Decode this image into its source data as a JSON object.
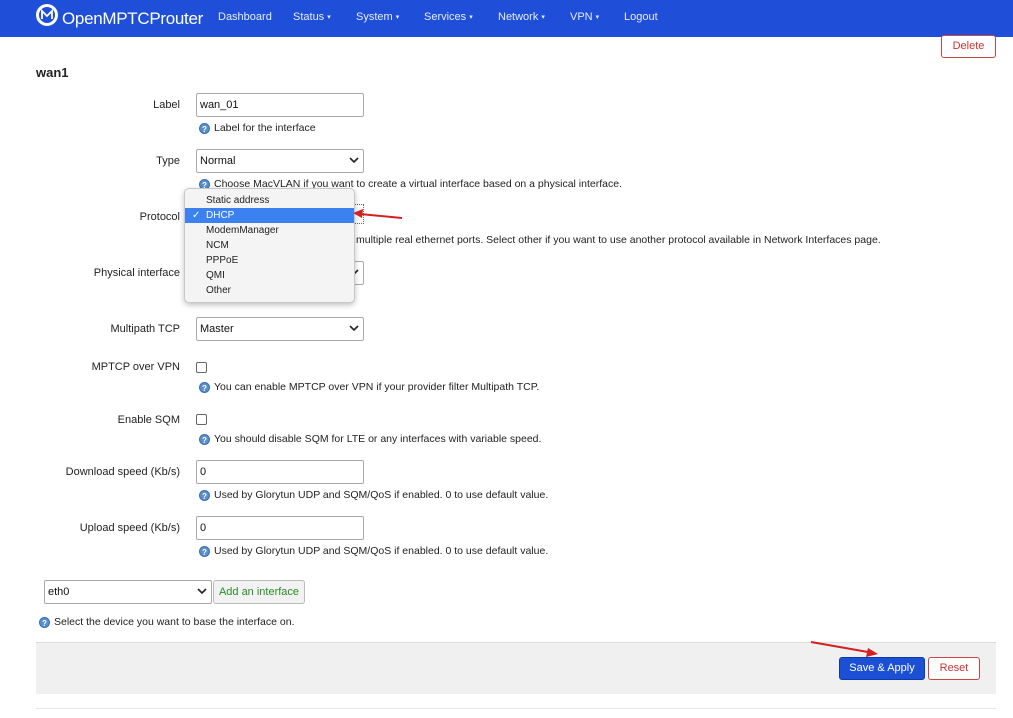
{
  "brand": {
    "name": "OpenMPTCProuter"
  },
  "nav": [
    {
      "label": "Dashboard",
      "dropdown": false
    },
    {
      "label": "Status",
      "dropdown": true
    },
    {
      "label": "System",
      "dropdown": true
    },
    {
      "label": "Services",
      "dropdown": true
    },
    {
      "label": "Network",
      "dropdown": true
    },
    {
      "label": "VPN",
      "dropdown": true
    },
    {
      "label": "Logout",
      "dropdown": false
    }
  ],
  "caret": "▾",
  "section": {
    "title": "wan1",
    "delete_label": "Delete"
  },
  "form": {
    "label": {
      "label": "Label",
      "value": "wan_01",
      "help": "Label for the interface"
    },
    "type": {
      "label": "Type",
      "value": "Normal",
      "help": "Choose MacVLAN if you want to create a virtual interface based on a physical interface."
    },
    "protocol": {
      "label": "Protocol",
      "help_fragment": "multiple real ethernet ports. Select other if you want to use another protocol available in Network Interfaces page.",
      "options": [
        "Static address",
        "DHCP",
        "ModemManager",
        "NCM",
        "PPPoE",
        "QMI",
        "Other"
      ],
      "selected": "DHCP",
      "check_mark": "✓"
    },
    "physical_interface": {
      "label": "Physical interface"
    },
    "multipath_tcp": {
      "label": "Multipath TCP",
      "value": "Master"
    },
    "mptcp_over_vpn": {
      "label": "MPTCP over VPN",
      "checked": false,
      "help": "You can enable MPTCP over VPN if your provider filter Multipath TCP."
    },
    "enable_sqm": {
      "label": "Enable SQM",
      "checked": false,
      "help": "You should disable SQM for LTE or any interfaces with variable speed."
    },
    "download_speed": {
      "label": "Download speed (Kb/s)",
      "value": "0",
      "help": "Used by Glorytun UDP and SQM/QoS if enabled. 0 to use default value."
    },
    "upload_speed": {
      "label": "Upload speed (Kb/s)",
      "value": "0",
      "help": "Used by Glorytun UDP and SQM/QoS if enabled. 0 to use default value."
    }
  },
  "add_interface": {
    "device_value": "eth0",
    "button_label": "Add an interface",
    "help": "Select the device you want to base the interface on."
  },
  "footer": {
    "save_label": "Save & Apply",
    "reset_label": "Reset"
  },
  "colors": {
    "navbar": "#1f4fd8",
    "primary": "#1a4fd6",
    "danger": "#cc3333",
    "arrow": "#d42020"
  }
}
